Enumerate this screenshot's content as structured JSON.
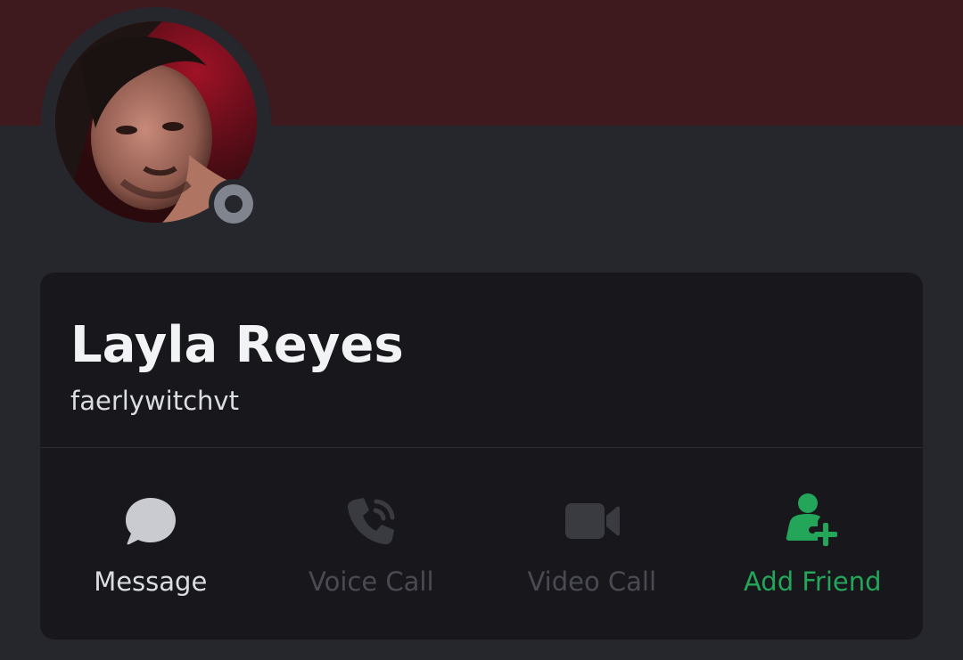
{
  "profile": {
    "display_name": "Layla Reyes",
    "username": "faerlywitchvt",
    "status": "offline",
    "banner_color": "#3e191d"
  },
  "actions": {
    "message": {
      "label": "Message",
      "icon": "chat-bubble-icon",
      "enabled": true
    },
    "voice_call": {
      "label": "Voice Call",
      "icon": "phone-icon",
      "enabled": false
    },
    "video_call": {
      "label": "Video Call",
      "icon": "video-camera-icon",
      "enabled": false
    },
    "add_friend": {
      "label": "Add Friend",
      "icon": "add-friend-icon",
      "enabled": true
    }
  },
  "colors": {
    "background": "#26272d",
    "card": "#18181c",
    "text_primary": "#f2f3f5",
    "text_muted": "#4a4b52",
    "accent_green": "#23a55a",
    "status_offline": "#80848e"
  }
}
